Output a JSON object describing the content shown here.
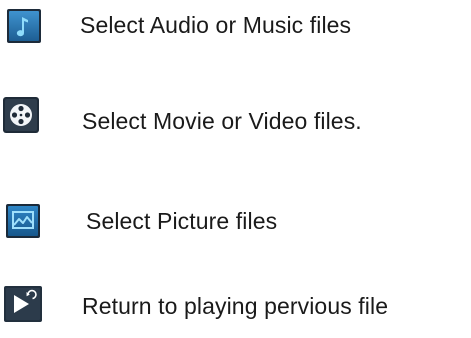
{
  "items": [
    {
      "icon": "music-note-icon",
      "label": "Select Audio or Music files"
    },
    {
      "icon": "film-reel-icon",
      "label": "Select Movie or Video files."
    },
    {
      "icon": "picture-icon",
      "label": "Select Picture files"
    },
    {
      "icon": "return-play-icon",
      "label": "Return to playing pervious file"
    }
  ],
  "colors": {
    "icon_dark": "#1d2b3a",
    "icon_blue": "#2a77b5",
    "icon_light": "#7fd0f2",
    "text": "#1a1a1a"
  }
}
